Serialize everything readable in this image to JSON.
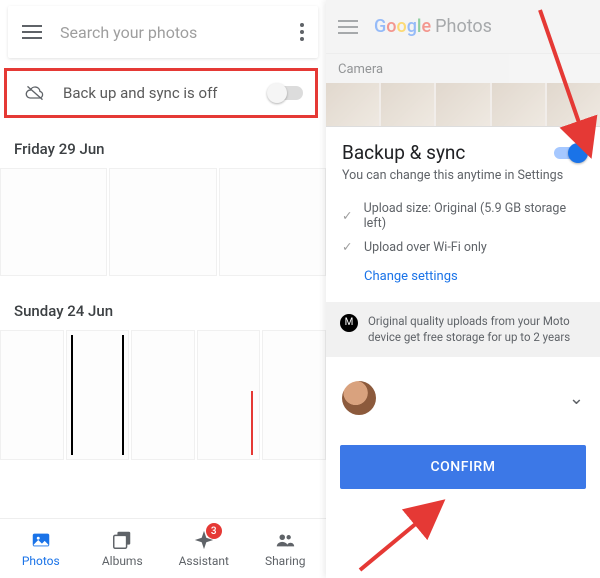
{
  "left": {
    "search_placeholder": "Search your photos",
    "banner_text": "Back up and sync is off",
    "sections": [
      {
        "label": "Friday 29 Jun"
      },
      {
        "label": "Sunday 24 Jun"
      }
    ],
    "nav": {
      "photos": "Photos",
      "albums": "Albums",
      "assistant": "Assistant",
      "assistant_badge": "3",
      "sharing": "Sharing"
    }
  },
  "right": {
    "app_name_1": "G",
    "app_name_rest": "oogle",
    "app_name_suffix": "Photos",
    "folder_label": "Camera",
    "sheet_title": "Backup & sync",
    "sheet_subtitle": "You can change this anytime in Settings",
    "upload_size": "Upload size: Original (5.9 GB storage left)",
    "upload_wifi": "Upload over Wi-Fi only",
    "change_settings": "Change settings",
    "promo": "Original quality uploads from your Moto device get free storage for up to 2 years",
    "confirm": "CONFIRM"
  }
}
